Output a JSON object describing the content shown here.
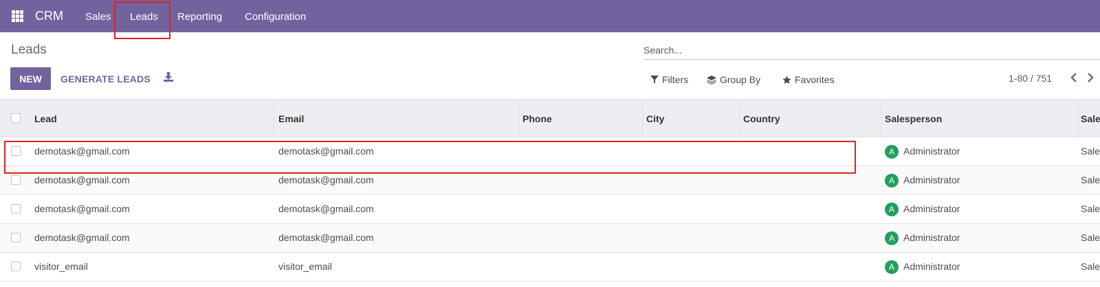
{
  "navbar": {
    "brand": "CRM",
    "items": [
      "Sales",
      "Leads",
      "Reporting",
      "Configuration"
    ],
    "bg_color": "#71639e"
  },
  "control_panel": {
    "title": "Leads",
    "new_label": "NEW",
    "generate_label": "GENERATE LEADS",
    "search_placeholder": "Search...",
    "filters_label": "Filters",
    "groupby_label": "Group By",
    "favorites_label": "Favorites",
    "pager": "1-80 / 751"
  },
  "table": {
    "columns": [
      "Lead",
      "Email",
      "Phone",
      "City",
      "Country",
      "Salesperson",
      "Sales"
    ],
    "rows": [
      {
        "lead": "demotask@gmail.com",
        "email": "demotask@gmail.com",
        "phone": "",
        "city": "",
        "country": "",
        "avatar": "A",
        "salesperson": "Administrator",
        "team": "Sales"
      },
      {
        "lead": "demotask@gmail.com",
        "email": "demotask@gmail.com",
        "phone": "",
        "city": "",
        "country": "",
        "avatar": "A",
        "salesperson": "Administrator",
        "team": "Sales"
      },
      {
        "lead": "demotask@gmail.com",
        "email": "demotask@gmail.com",
        "phone": "",
        "city": "",
        "country": "",
        "avatar": "A",
        "salesperson": "Administrator",
        "team": "Sales"
      },
      {
        "lead": "demotask@gmail.com",
        "email": "demotask@gmail.com",
        "phone": "",
        "city": "",
        "country": "",
        "avatar": "A",
        "salesperson": "Administrator",
        "team": "Sales"
      },
      {
        "lead": "visitor_email",
        "email": "visitor_email",
        "phone": "",
        "city": "",
        "country": "",
        "avatar": "A",
        "salesperson": "Administrator",
        "team": "Sales"
      }
    ]
  },
  "colors": {
    "accent": "#71639e",
    "highlight": "#e0201f",
    "avatar": "#21a05c"
  }
}
